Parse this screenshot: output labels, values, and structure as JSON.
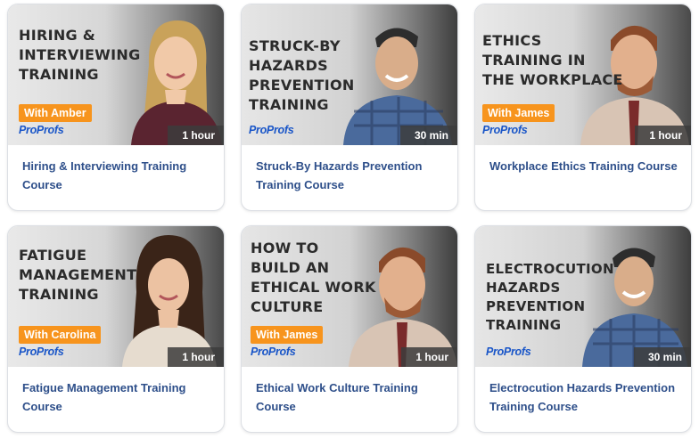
{
  "brand_logo": "ProProfs",
  "colors": {
    "badge": "#f7941d",
    "caption": "#2e4f8a",
    "logo": "#1a56c8",
    "duration_bg": "#3c3c3c"
  },
  "courses": [
    {
      "thumbnail_title": "HIRING &\nINTERVIEWING\nTRAINING",
      "instructor_badge": "With Amber",
      "duration": "1 hour",
      "caption": "Hiring & Interviewing Training Course"
    },
    {
      "thumbnail_title": "STRUCK-BY\nHAZARDS\nPREVENTION\nTRAINING",
      "instructor_badge": "",
      "duration": "30 min",
      "caption": "Struck-By Hazards Prevention Training Course"
    },
    {
      "thumbnail_title": "ETHICS\nTRAINING IN\nTHE WORKPLACE",
      "instructor_badge": "With James",
      "duration": "1 hour",
      "caption": "Workplace Ethics Training Course"
    },
    {
      "thumbnail_title": "FATIGUE\nMANAGEMENT\nTRAINING",
      "instructor_badge": "With Carolina",
      "duration": "1 hour",
      "caption": "Fatigue Management Training Course"
    },
    {
      "thumbnail_title": "HOW TO\nBUILD AN\nETHICAL WORK\nCULTURE",
      "instructor_badge": "With James",
      "duration": "1 hour",
      "caption": "Ethical Work Culture Training Course"
    },
    {
      "thumbnail_title": "ELECTROCUTION\nHAZARDS\nPREVENTION\nTRAINING",
      "instructor_badge": "",
      "duration": "30 min",
      "caption": "Electrocution Hazards Prevention Training Course"
    }
  ]
}
